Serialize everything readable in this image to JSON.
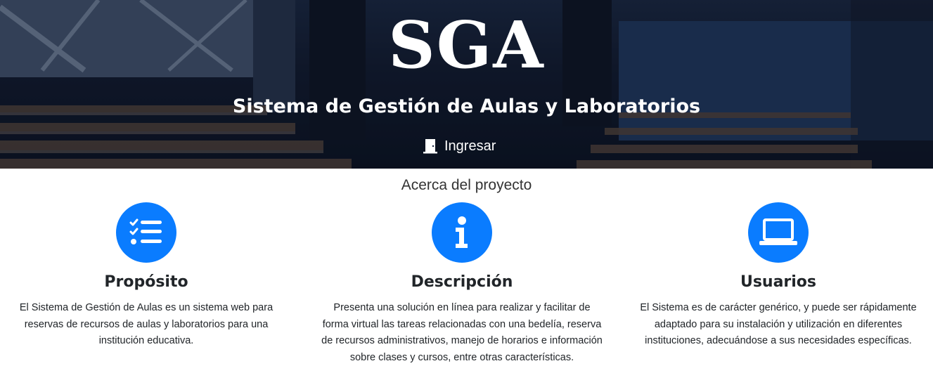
{
  "hero": {
    "brand": "SGA",
    "subtitle": "Sistema de Gestión de Aulas y Laboratorios",
    "login_label": "Ingresar",
    "login_icon": "door-open-icon"
  },
  "about": {
    "title": "Acerca del proyecto",
    "accent_color": "#0a7cff",
    "columns": [
      {
        "icon": "checklist-icon",
        "heading": "Propósito",
        "text": "El Sistema de Gestión de Aulas es un sistema web para reservas de recursos de aulas y laboratorios para una institución educativa."
      },
      {
        "icon": "info-icon",
        "heading": "Descripción",
        "text": "Presenta una solución en línea para realizar y facilitar de forma virtual las tareas relacionadas con una bedelía, reserva de recursos administrativos, manejo de horarios e información sobre clases y cursos, entre otras características."
      },
      {
        "icon": "laptop-icon",
        "heading": "Usuarios",
        "text": "El Sistema es de carácter genérico, y puede ser rápidamente adaptado para su instalación y utilización en diferentes instituciones, adecuándose a sus necesidades específicas."
      }
    ]
  }
}
